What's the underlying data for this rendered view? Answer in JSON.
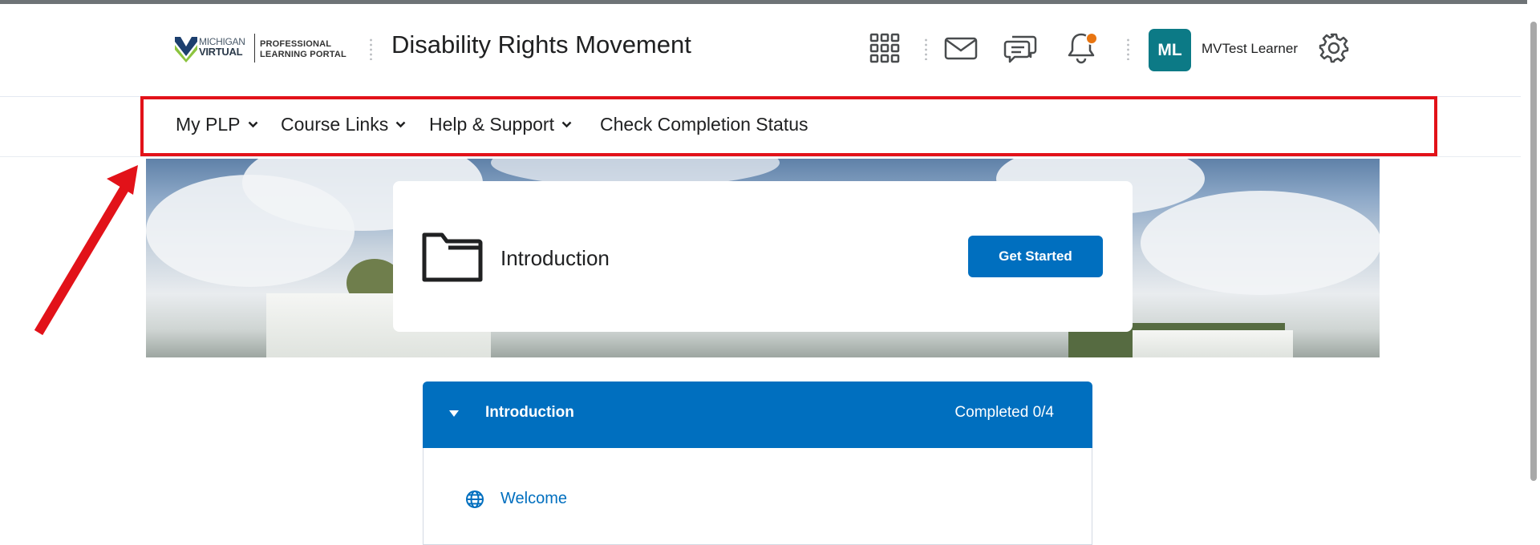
{
  "header": {
    "logo": {
      "line1": "MICHIGAN",
      "line2": "VIRTUAL",
      "line3": "PROFESSIONAL",
      "line4": "LEARNING PORTAL"
    },
    "course_title": "Disability Rights Movement",
    "icons": [
      "apps-grid-icon",
      "mail-icon",
      "chat-icon",
      "bell-icon",
      "gear-icon"
    ],
    "user": {
      "initials": "ML",
      "name": "MVTest Learner",
      "avatar_color": "#0c7a86"
    },
    "notification_dot_color": "#e87511"
  },
  "nav": {
    "items": [
      {
        "label": "My PLP",
        "has_dropdown": true
      },
      {
        "label": "Course Links",
        "has_dropdown": true
      },
      {
        "label": "Help & Support",
        "has_dropdown": true
      },
      {
        "label": "Check Completion Status",
        "has_dropdown": false
      }
    ],
    "highlight_color": "#e21219"
  },
  "hero": {
    "card_title": "Introduction",
    "button_label": "Get Started"
  },
  "module": {
    "title": "Introduction",
    "status": "Completed 0/4",
    "items": [
      {
        "label": "Welcome",
        "icon": "globe-icon"
      }
    ]
  },
  "colors": {
    "accent": "#006fbf",
    "annotation": "#e21219"
  }
}
